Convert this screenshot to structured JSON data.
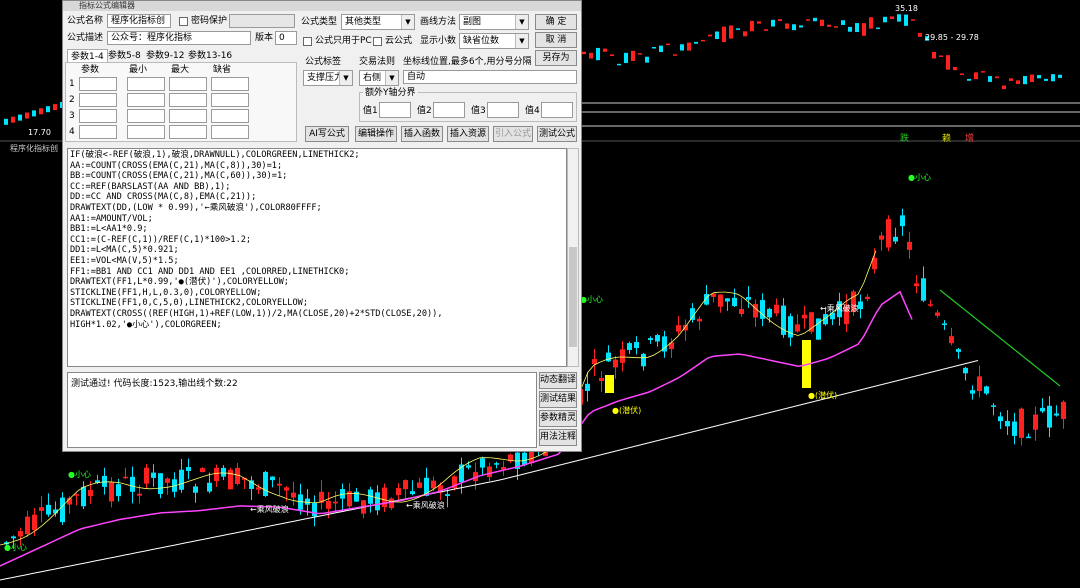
{
  "dialog": {
    "title": "指标公式编辑器",
    "formula_name_label": "公式名称",
    "formula_name": "程序化指标创",
    "password_label": "密码保护",
    "formula_desc_label": "公式描述",
    "formula_desc": "公众号：程序化指标",
    "version_label": "版本",
    "version": "0",
    "param_tabs": [
      "参数1-4",
      "参数5-8",
      "参数9-12",
      "参数13-16"
    ],
    "param_headers": [
      "参数",
      "最小",
      "最大",
      "缺省"
    ],
    "param_rows": [
      "1",
      "2",
      "3",
      "4"
    ],
    "type_label": "公式类型",
    "type_value": "其他类型",
    "draw_label": "画线方法",
    "draw_value": "副图",
    "ok": "确 定",
    "cancel": "取 消",
    "save_as": "另存为",
    "pc_only": "公式只用于PC",
    "cloud": "云公式",
    "decimals_label": "显示小数",
    "decimals_value": "缺省位数",
    "tag_label": "公式标签",
    "trade_rule_label": "交易法则",
    "coord_label": "坐标线位置,最多6个,用分号分隔",
    "tag_value": "支撑压力",
    "trade_side": "右侧",
    "coord_value": "自动",
    "extra_y_label": "额外Y轴分界",
    "vals": [
      "值1",
      "值2",
      "值3",
      "值4"
    ],
    "buttons": [
      "AI写公式",
      "编辑操作",
      "插入函数",
      "插入资源",
      "引入公式",
      "测试公式"
    ],
    "status_text": "测试通过! 代码长度:1523,输出线个数:22",
    "side_buttons": [
      "动态翻译",
      "测试结果",
      "参数精灵",
      "用法注释"
    ]
  },
  "code_lines": [
    "IF(破浪<-REF(破浪,1),破浪,DRAWNULL),COLORGREEN,LINETHICK2;",
    "AA:=COUNT(CROSS(EMA(C,21),MA(C,8)),30)=1;",
    "BB:=COUNT(CROSS(EMA(C,21),MA(C,60)),30)=1;",
    "CC:=REF(BARSLAST(AA AND BB),1);",
    "DD:=CC AND CROSS(MA(C,8),EMA(C,21));",
    "DRAWTEXT(DD,(LOW * 0.99),'←乘风破浪'),COLOR80FFFF;",
    "AA1:=AMOUNT/VOL;",
    "BB1:=L<AA1*0.9;",
    "CC1:=(C-REF(C,1))/REF(C,1)*100>1.2;",
    "DD1:=L<MA(C,5)*0.921;",
    "EE1:=VOL<MA(V,5)*1.5;",
    "FF1:=BB1 AND CC1 AND DD1 AND EE1 ,COLORRED,LINETHICK0;",
    "DRAWTEXT(FF1,L*0.99,'●(潜伏)'),COLORYELLOW;",
    "STICKLINE(FF1,H,L,0.3,0),COLORYELLOW;",
    "STICKLINE(FF1,0,C,5,0),LINETHICK2,COLORYELLOW;",
    "DRAWTEXT(CROSS((REF(HIGH,1)+REF(LOW,1))/2,MA(CLOSE,20)+2*STD(CLOSE,20)),",
    "HIGH*1.02,'●小心'),COLORGREEN;"
  ],
  "chart": {
    "panel_title": "程序化指标创",
    "price_labels": [
      "35.18",
      "29.85 - 29.78",
      "17.70"
    ],
    "signal_labels": [
      "跌",
      "赖",
      "增"
    ],
    "annotations": [
      "●小心",
      "●小心",
      "●小心",
      "●小心",
      "←乘风破浪",
      "←乘风破浪",
      "←乘风破浪",
      "●(潜伏)",
      "●(潜伏)"
    ],
    "colors": {
      "up": "#ff2020",
      "down": "#00e5ff",
      "ma_yellow": "#ffff66",
      "ma_magenta": "#ff44ff",
      "ma_white": "#ffffff",
      "ma_green": "#22cc22",
      "warn": "#ffff00"
    }
  }
}
